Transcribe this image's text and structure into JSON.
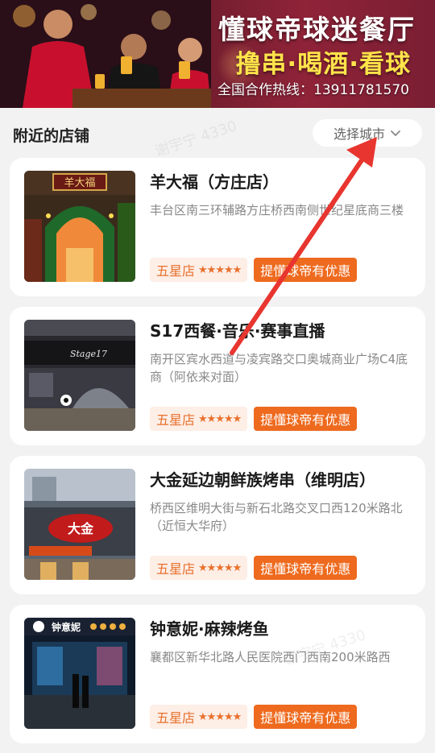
{
  "banner": {
    "title": "懂球帝球迷餐厅",
    "slogan": "撸串·喝酒·看球",
    "hotline": "全国合作热线：13911781570"
  },
  "section": {
    "title": "附近的店铺",
    "city_select_label": "选择城市"
  },
  "restaurants": [
    {
      "name": "羊大福（方庄店）",
      "address": "丰台区南三环辅路方庄桥西南侧世纪星底商三楼",
      "rating_label": "五星店",
      "stars": "★★★★★",
      "promo": "提懂球帝有优惠",
      "sign_text": "羊大福"
    },
    {
      "name": "S17西餐·音乐·赛事直播",
      "address": "南开区宾水西道与凌宾路交口奥城商业广场C4底商（阿依来对面）",
      "rating_label": "五星店",
      "stars": "★★★★★",
      "promo": "提懂球帝有优惠",
      "sign_text": "Stage17"
    },
    {
      "name": "大金延边朝鲜族烤串（维明店）",
      "address": "桥西区维明大街与新石北路交叉口西120米路北（近恒大华府）",
      "rating_label": "五星店",
      "stars": "★★★★★",
      "promo": "提懂球帝有优惠",
      "sign_text": "大金"
    },
    {
      "name": "钟意妮·麻辣烤鱼",
      "address": "襄都区新华北路人民医院西门西南200米路西",
      "rating_label": "五星店",
      "stars": "★★★★★",
      "promo": "提懂球帝有优惠",
      "sign_text": "钟意妮"
    }
  ],
  "watermark": "谢宇宁 4330",
  "colors": {
    "accent": "#ee6a1e",
    "badge_bg": "#fdeee6",
    "arrow": "#e8352f",
    "banner": "#8f2338"
  }
}
